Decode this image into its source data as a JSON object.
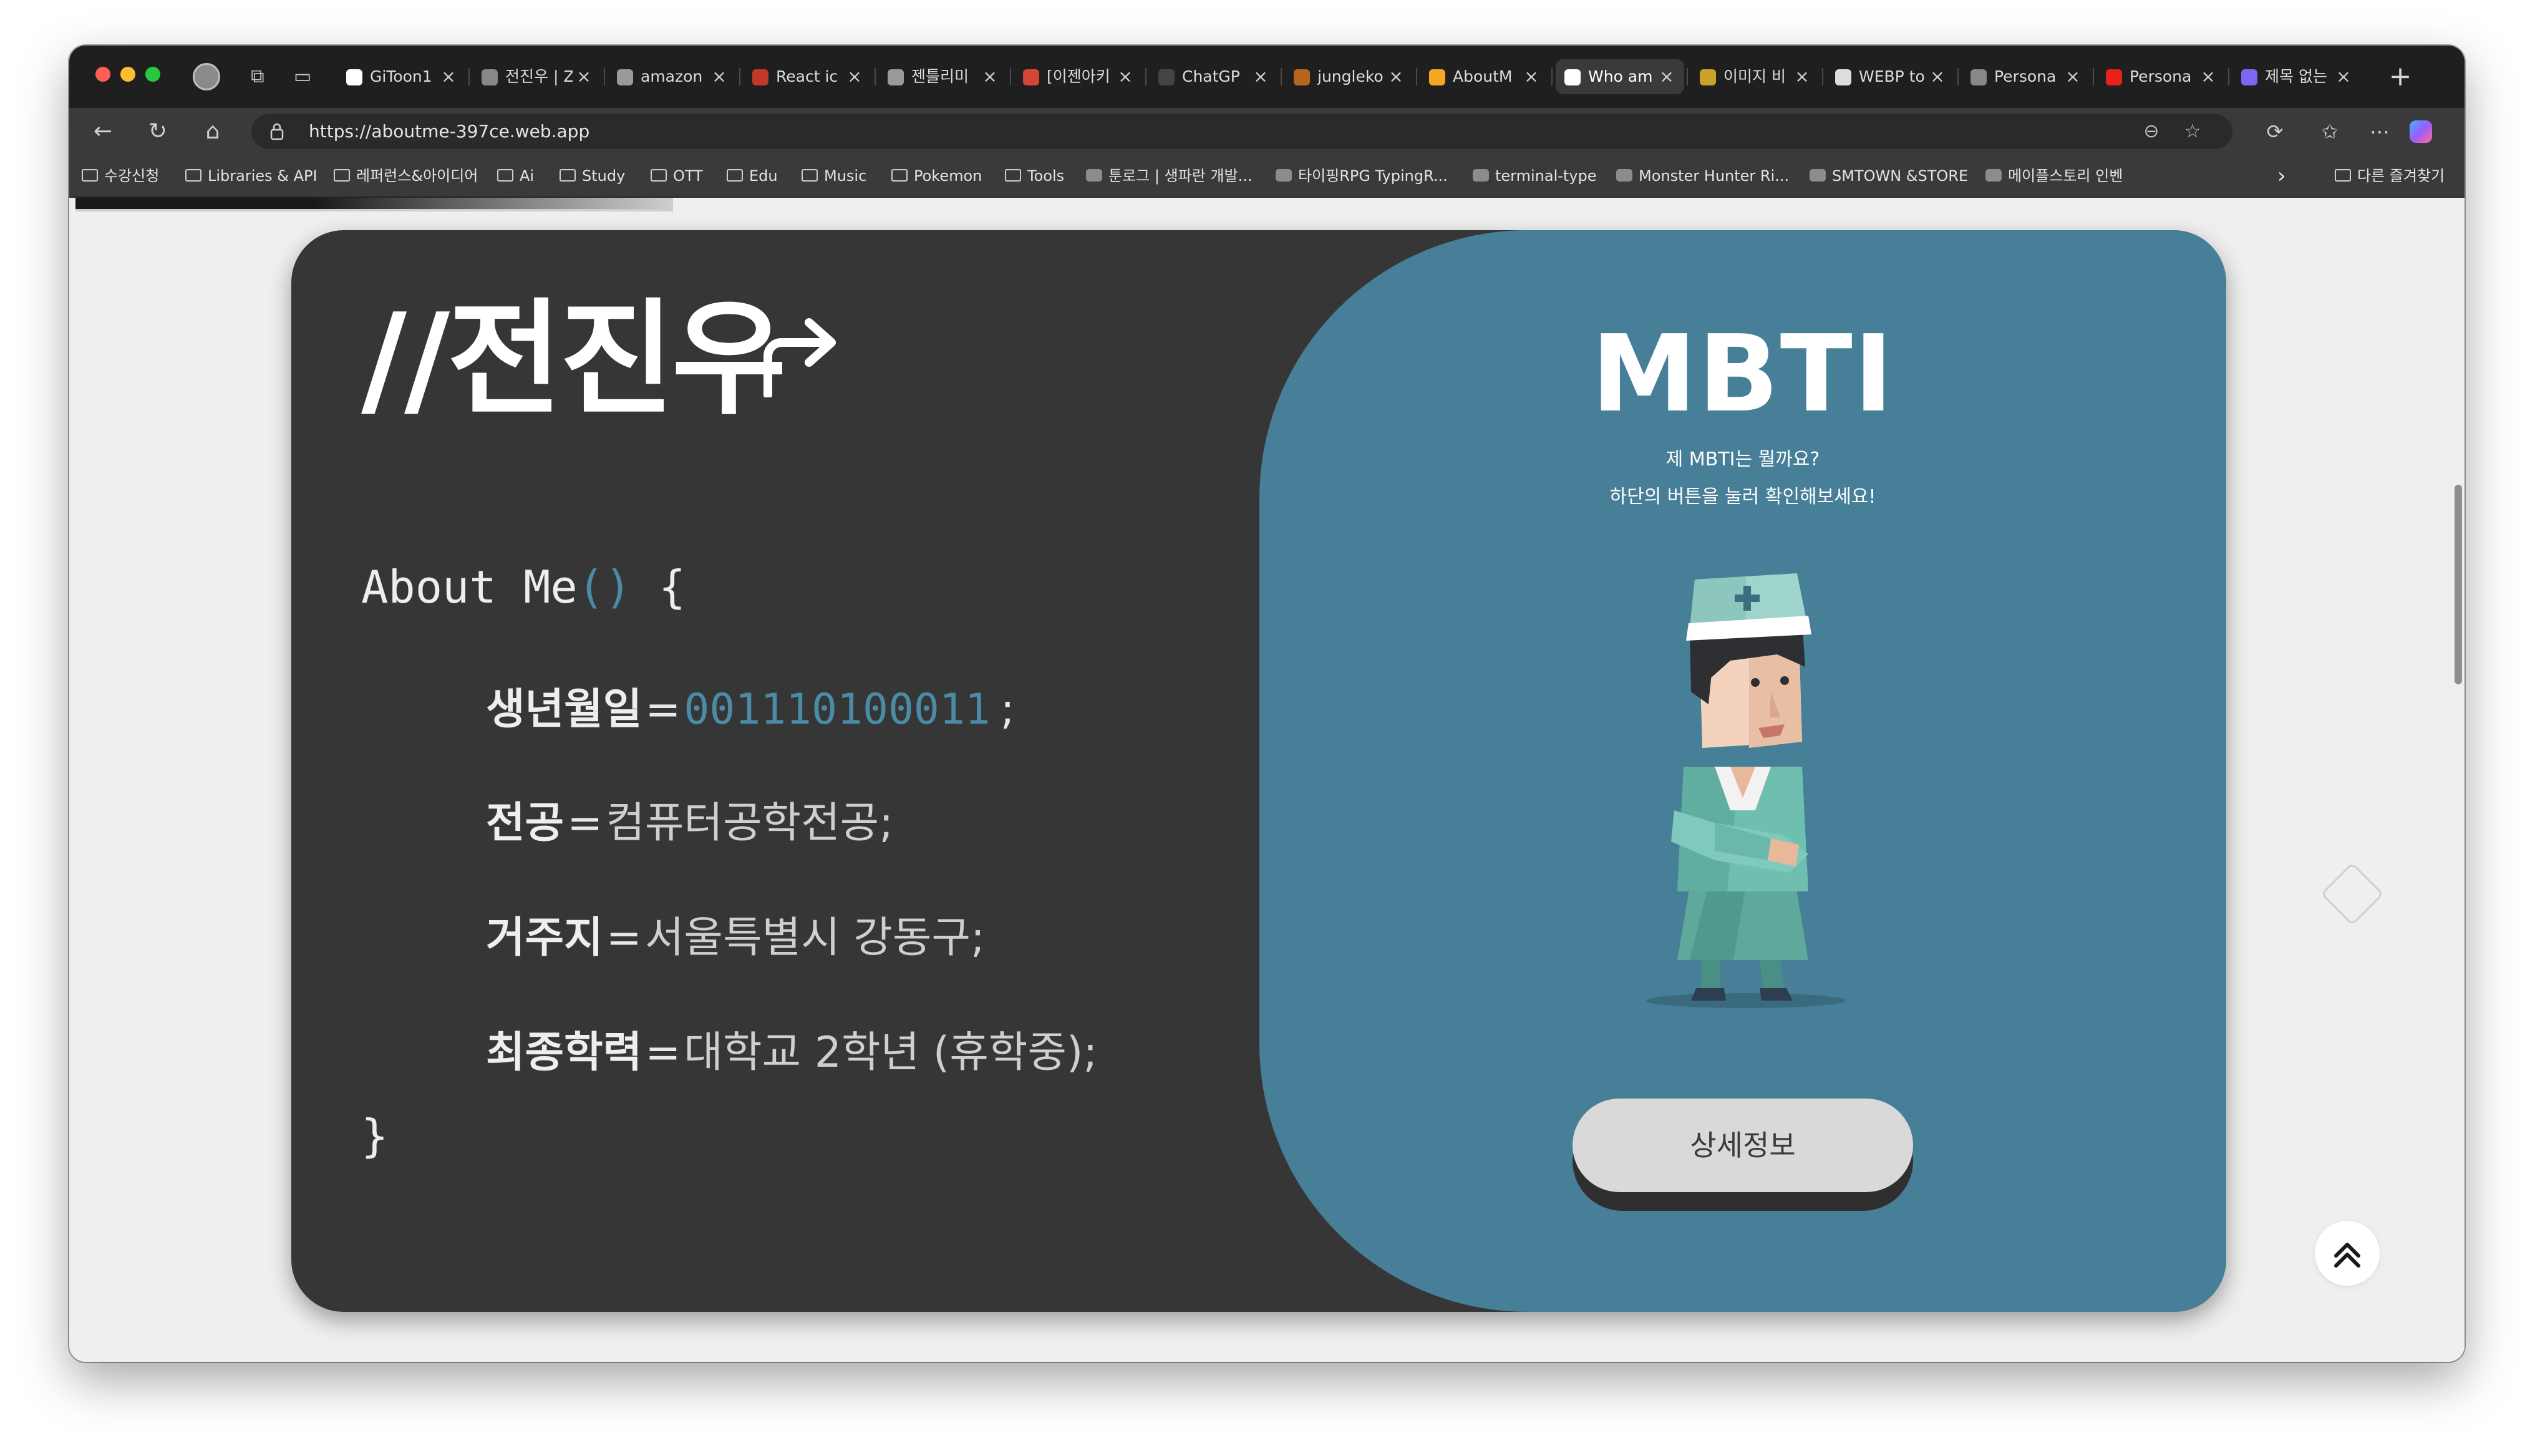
{
  "browser": {
    "tabs": [
      {
        "title": "GiToon1",
        "favicon": "github-icon",
        "color": "#ffffff"
      },
      {
        "title": "전진우 | Z",
        "favicon": "notion-icon",
        "color": "#888888"
      },
      {
        "title": "amazon",
        "favicon": "chrome-icon",
        "color": "#9a9a9a"
      },
      {
        "title": "React ic",
        "favicon": "react-icon",
        "color": "#c0392b"
      },
      {
        "title": "젠틀리미",
        "favicon": "chrome-icon",
        "color": "#9a9a9a"
      },
      {
        "title": "[이젠아키",
        "favicon": "gmail-icon",
        "color": "#d44638"
      },
      {
        "title": "ChatGP",
        "favicon": "openai-icon",
        "color": "#444444"
      },
      {
        "title": "jungleko",
        "favicon": "jungle-icon",
        "color": "#b5651d"
      },
      {
        "title": "AboutM",
        "favicon": "firebase-icon",
        "color": "#f5a623"
      },
      {
        "title": "Who am",
        "favicon": "redirect-icon",
        "color": "#ffffff",
        "active": true
      },
      {
        "title": "이미지 비",
        "favicon": "image-icon",
        "color": "#c9a227"
      },
      {
        "title": "WEBP to",
        "favicon": "cloud-icon",
        "color": "#dddddd"
      },
      {
        "title": "Persona",
        "favicon": "pen-icon",
        "color": "#888888"
      },
      {
        "title": "Persona",
        "favicon": "youtube-icon",
        "color": "#e62117"
      },
      {
        "title": "제목 없는",
        "favicon": "doc-icon",
        "color": "#7b68ee"
      }
    ],
    "close_glyph": "×",
    "new_tab_glyph": "+",
    "url": "https://aboutme-397ce.web.app",
    "bookmarks": [
      {
        "label": "수강신청",
        "type": "folder"
      },
      {
        "label": "Libraries & API",
        "type": "folder"
      },
      {
        "label": "레퍼런스&아이디어",
        "type": "folder"
      },
      {
        "label": "Ai",
        "type": "folder"
      },
      {
        "label": "Study",
        "type": "folder"
      },
      {
        "label": "OTT",
        "type": "folder"
      },
      {
        "label": "Edu",
        "type": "folder"
      },
      {
        "label": "Music",
        "type": "folder"
      },
      {
        "label": "Pokemon",
        "type": "folder"
      },
      {
        "label": "Tools",
        "type": "folder"
      },
      {
        "label": "툰로그 | 생파란 개발...",
        "type": "site"
      },
      {
        "label": "타이핑RPG TypingR...",
        "type": "site"
      },
      {
        "label": "terminal-type",
        "type": "site"
      },
      {
        "label": "Monster Hunter Ri...",
        "type": "site"
      },
      {
        "label": "SMTOWN &STORE",
        "type": "site"
      },
      {
        "label": "메이플스토리 인벤",
        "type": "site"
      }
    ],
    "other_bookmarks": "다른 즐겨찾기",
    "overflow_glyph": "›"
  },
  "page": {
    "title": "//전진우",
    "about": {
      "open_keyword": "About Me",
      "open_parens": "()",
      "open_brace": "{",
      "close_brace": "}",
      "rows": [
        {
          "key": "생년월일",
          "eq": "=",
          "value": "001110100011",
          "tail": ";"
        },
        {
          "key": "전공",
          "eq": "=",
          "value": "컴퓨터공학전공;",
          "tail": ""
        },
        {
          "key": "거주지",
          "eq": "=",
          "value": "서울특별시 강동구;",
          "tail": ""
        },
        {
          "key": "최종학력",
          "eq": "=",
          "value": "대학교 2학년 (휴학중);",
          "tail": ""
        }
      ]
    },
    "mbti": {
      "title": "MBTI",
      "line1": "제 MBTI는 뭘까요?",
      "line2": "하단의 버튼을 눌러 확인해보세요!",
      "button": "상세정보"
    }
  },
  "colors": {
    "card_bg": "#363636",
    "mbti_bg": "#467f97",
    "accent_blue": "#4a8ba5"
  }
}
